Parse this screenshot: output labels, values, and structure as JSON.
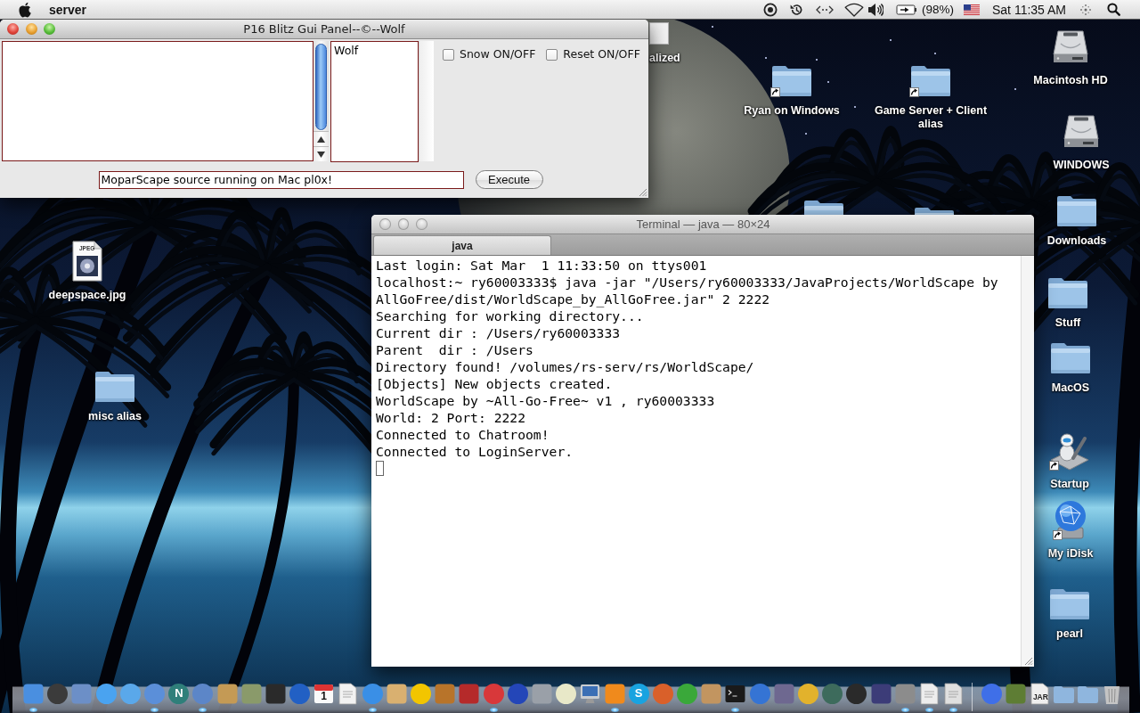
{
  "menu_bar": {
    "app_name": "server",
    "battery_reading": "(98%)",
    "clock": "Sat 11:35 AM"
  },
  "desktop_icons": [
    {
      "kind": "document",
      "label": "alized"
    },
    {
      "kind": "folder",
      "label": "Ryan on Windows",
      "alias": true
    },
    {
      "kind": "folder",
      "label": "Game Server + Client alias",
      "alias": true
    },
    {
      "kind": "drive",
      "label": "Macintosh HD",
      "alias": false
    },
    {
      "kind": "drive",
      "label": "WINDOWS",
      "alias": false
    },
    {
      "kind": "folder"
    },
    {
      "kind": "folder"
    },
    {
      "kind": "folder",
      "label": "Downloads",
      "alias": false
    },
    {
      "kind": "image",
      "label": "deepspace.jpg",
      "badge": "JPEG",
      "alias": false
    },
    {
      "kind": "folder",
      "label": "Stuff",
      "alias": false
    },
    {
      "kind": "folder",
      "label": "MacOS",
      "alias": false
    },
    {
      "kind": "folder",
      "label": "misc alias",
      "alias": false
    },
    {
      "kind": "robot",
      "label": "Startup",
      "alias": true
    },
    {
      "kind": "globe",
      "label": "My iDisk",
      "alias": true
    },
    {
      "kind": "folder",
      "label": "pearl",
      "alias": false
    }
  ],
  "blitz_panel": {
    "title": "P16 Blitz Gui Panel--©--Wolf",
    "active": true,
    "users": [
      "Wolf"
    ],
    "options": [
      {
        "label": "Snow ON/OFF",
        "checked": false
      },
      {
        "label": "Reset ON/OFF",
        "checked": false
      }
    ],
    "command": {
      "value": "MoparScape source running on Mac pl0x!"
    },
    "execute_button": "Execute"
  },
  "terminal": {
    "title": "Terminal — java — 80×24",
    "active": false,
    "tabs": [
      {
        "label": "java",
        "selected": true
      }
    ],
    "lines": [
      "Last login: Sat Mar  1 11:33:50 on ttys001",
      "localhost:~ ry60003333$ java -jar \"/Users/ry60003333/JavaProjects/WorldScape by AllGoFree/dist/WorldScape_by_AllGoFree.jar\" 2 2222",
      "Searching for working directory...",
      "Current dir : /Users/ry60003333",
      "Parent  dir : /Users",
      "Directory found! /volumes/rs-serv/rs/WorldScape/",
      "[Objects] New objects created.",
      "WorldScape by ~All-Go-Free~ v1 , ry60003333",
      "World: 2 Port: 2222",
      "Connected to Chatroom!",
      "Connected to LoginServer."
    ]
  },
  "dock": {
    "items": [
      {
        "kind": "tile",
        "color": "#4a8fe0",
        "running": true
      },
      {
        "kind": "disc",
        "color": "#3b3b3b",
        "running": false
      },
      {
        "kind": "tile",
        "color": "#6c8fc7",
        "running": false
      },
      {
        "kind": "disc",
        "color": "#4aa3f0",
        "running": false
      },
      {
        "kind": "disc",
        "color": "#5aa8ea",
        "running": false
      },
      {
        "kind": "disc",
        "color": "#5b8fd9",
        "running": true
      },
      {
        "kind": "disc",
        "color": "#2f7f7a",
        "glyph": "N",
        "running": false
      },
      {
        "kind": "disc",
        "color": "#5c86c8",
        "running": true
      },
      {
        "kind": "tile",
        "color": "#c49a55",
        "running": false
      },
      {
        "kind": "tile",
        "color": "#8a9a6a",
        "running": false
      },
      {
        "kind": "tile",
        "color": "#2a2a2a",
        "running": false
      },
      {
        "kind": "disc",
        "color": "#2260c4",
        "running": false
      },
      {
        "kind": "calendar",
        "color": "#dd3333",
        "glyph": "1",
        "running": false
      },
      {
        "kind": "doc",
        "color": "#f2f2f2",
        "running": false
      },
      {
        "kind": "disc",
        "color": "#3a8fe6",
        "running": true
      },
      {
        "kind": "tile",
        "color": "#d9b070",
        "running": false
      },
      {
        "kind": "disc",
        "color": "#f2c500",
        "running": false
      },
      {
        "kind": "tile",
        "color": "#b8742a",
        "running": false
      },
      {
        "kind": "tile",
        "color": "#b52a2a",
        "running": false
      },
      {
        "kind": "disc",
        "color": "#d8383a",
        "running": true
      },
      {
        "kind": "disc",
        "color": "#2446b8",
        "running": false
      },
      {
        "kind": "tile",
        "color": "#9aa0a8",
        "running": false
      },
      {
        "kind": "disc",
        "color": "#e8e8c8",
        "running": false
      },
      {
        "kind": "screen",
        "color": "#c8ccd0",
        "running": false
      },
      {
        "kind": "tile",
        "color": "#f08a1c",
        "running": true
      },
      {
        "kind": "disc",
        "color": "#19a3e0",
        "glyph": "S",
        "running": false
      },
      {
        "kind": "disc",
        "color": "#d9602a",
        "running": false
      },
      {
        "kind": "disc",
        "color": "#3aa83a",
        "running": false
      },
      {
        "kind": "tile",
        "color": "#c29560",
        "running": false
      },
      {
        "kind": "terminal",
        "color": "#1a1a1a",
        "running": true
      },
      {
        "kind": "disc",
        "color": "#3574d4",
        "running": false
      },
      {
        "kind": "tile",
        "color": "#6e6890",
        "running": false
      },
      {
        "kind": "disc",
        "color": "#e2b22c",
        "running": false
      },
      {
        "kind": "disc",
        "color": "#3d6b5c",
        "running": false
      },
      {
        "kind": "disc",
        "color": "#2a2a2a",
        "running": false
      },
      {
        "kind": "tile",
        "color": "#3c3c78",
        "running": false
      },
      {
        "kind": "tile",
        "color": "#8c8c8c",
        "running": true
      },
      {
        "kind": "doc",
        "color": "#ededed",
        "running": true
      },
      {
        "kind": "doc",
        "color": "#e0e0e0",
        "running": true
      },
      {
        "kind": "separator"
      },
      {
        "kind": "disc",
        "color": "#3f6fe8",
        "running": false
      },
      {
        "kind": "tile",
        "color": "#5e7d34",
        "running": false
      },
      {
        "kind": "doc",
        "color": "#efefef",
        "glyph": "JAR",
        "running": false
      },
      {
        "kind": "folder",
        "color": "#8fb6de",
        "running": false
      },
      {
        "kind": "folder",
        "color": "#8fb6de",
        "running": false
      },
      {
        "kind": "trash",
        "color": "#c4c4c4",
        "running": false
      }
    ]
  }
}
